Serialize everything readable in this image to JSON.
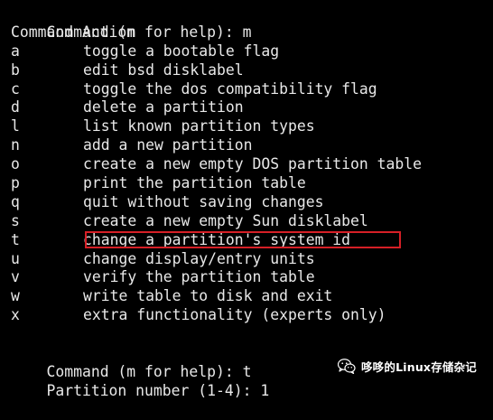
{
  "terminal": {
    "prompt1": {
      "text": "Command (m for help): m"
    },
    "header": "Command Action",
    "commands": [
      {
        "key": "a",
        "action": "toggle a bootable flag"
      },
      {
        "key": "b",
        "action": "edit bsd disklabel"
      },
      {
        "key": "c",
        "action": "toggle the dos compatibility flag"
      },
      {
        "key": "d",
        "action": "delete a partition"
      },
      {
        "key": "l",
        "action": "list known partition types"
      },
      {
        "key": "n",
        "action": "add a new partition"
      },
      {
        "key": "o",
        "action": "create a new empty DOS partition table"
      },
      {
        "key": "p",
        "action": "print the partition table"
      },
      {
        "key": "q",
        "action": "quit without saving changes"
      },
      {
        "key": "s",
        "action": "create a new empty Sun disklabel"
      },
      {
        "key": "t",
        "action": "change a partition's system id",
        "highlighted": true
      },
      {
        "key": "u",
        "action": "change display/entry units"
      },
      {
        "key": "v",
        "action": "verify the partition table"
      },
      {
        "key": "w",
        "action": "write table to disk and exit"
      },
      {
        "key": "x",
        "action": "extra functionality (experts only)"
      }
    ],
    "prompt2": {
      "text": "Command (m for help): t"
    },
    "prompt3": {
      "text": "Partition number (1-4): 1"
    }
  },
  "watermark": {
    "text": "哆哆的Linux存储杂记",
    "icon": "wechat-icon"
  },
  "colors": {
    "background": "#000000",
    "text": "#e8e8e8",
    "highlight_border": "#d61f26"
  }
}
